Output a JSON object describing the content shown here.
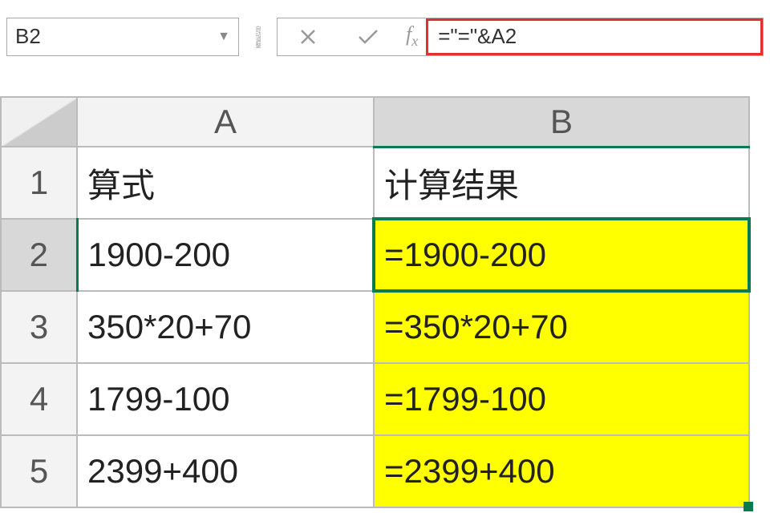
{
  "formula_bar": {
    "name_box": "B2",
    "formula": "=\"=\"&A2"
  },
  "columns": [
    "A",
    "B"
  ],
  "rows": [
    "1",
    "2",
    "3",
    "4",
    "5"
  ],
  "headers": {
    "A": "算式",
    "B": "计算结果"
  },
  "data": [
    {
      "A": "1900-200",
      "B": "=1900-200"
    },
    {
      "A": "350*20+70",
      "B": "=350*20+70"
    },
    {
      "A": "1799-100",
      "B": "=1799-100"
    },
    {
      "A": "2399+400",
      "B": "=2399+400"
    }
  ]
}
